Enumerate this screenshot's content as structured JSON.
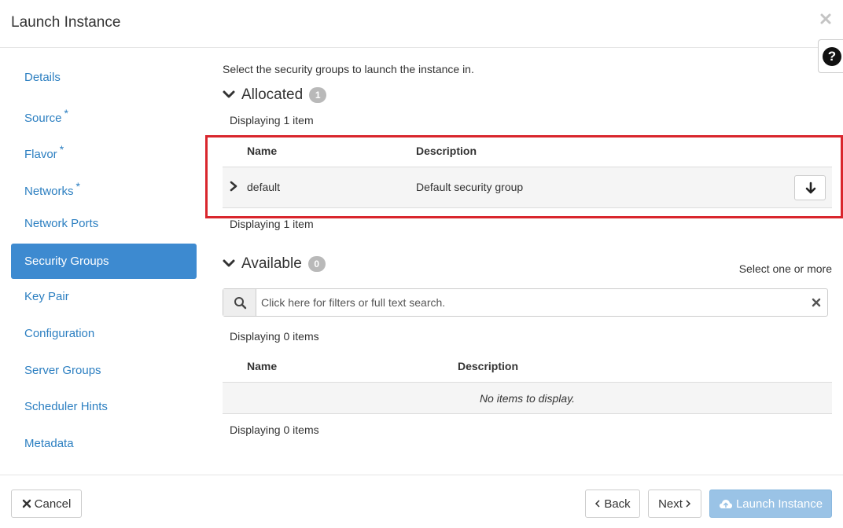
{
  "modal": {
    "title": "Launch Instance",
    "close_icon": "close-icon",
    "help_label": "?"
  },
  "sidebar": {
    "items": [
      {
        "label": "Details",
        "required": false,
        "active": false
      },
      {
        "label": "Source",
        "required": true,
        "active": false
      },
      {
        "label": "Flavor",
        "required": true,
        "active": false
      },
      {
        "label": "Networks",
        "required": true,
        "active": false
      },
      {
        "label": "Network Ports",
        "required": false,
        "active": false
      },
      {
        "label": "Security Groups",
        "required": false,
        "active": true
      },
      {
        "label": "Key Pair",
        "required": false,
        "active": false
      },
      {
        "label": "Configuration",
        "required": false,
        "active": false
      },
      {
        "label": "Server Groups",
        "required": false,
        "active": false
      },
      {
        "label": "Scheduler Hints",
        "required": false,
        "active": false
      },
      {
        "label": "Metadata",
        "required": false,
        "active": false
      }
    ],
    "required_marker": "*"
  },
  "main": {
    "intro": "Select the security groups to launch the instance in.",
    "allocated": {
      "heading": "Allocated",
      "count": "1",
      "displaying_top": "Displaying 1 item",
      "displaying_bottom": "Displaying 1 item",
      "columns": {
        "name": "Name",
        "description": "Description"
      },
      "rows": [
        {
          "name": "default",
          "description": "Default security group"
        }
      ]
    },
    "available": {
      "heading": "Available",
      "count": "0",
      "select_hint": "Select one or more",
      "search_placeholder": "Click here for filters or full text search.",
      "displaying_top": "Displaying 0 items",
      "displaying_bottom": "Displaying 0 items",
      "columns": {
        "name": "Name",
        "description": "Description"
      },
      "empty_message": "No items to display."
    }
  },
  "footer": {
    "cancel_label": "Cancel",
    "back_label": "Back",
    "next_label": "Next",
    "launch_label": "Launch Instance"
  },
  "colors": {
    "link": "#2c7fc1",
    "active_nav": "#3d8ad0",
    "highlight_border": "#d9262d",
    "primary_disabled": "#9ac3e6"
  }
}
